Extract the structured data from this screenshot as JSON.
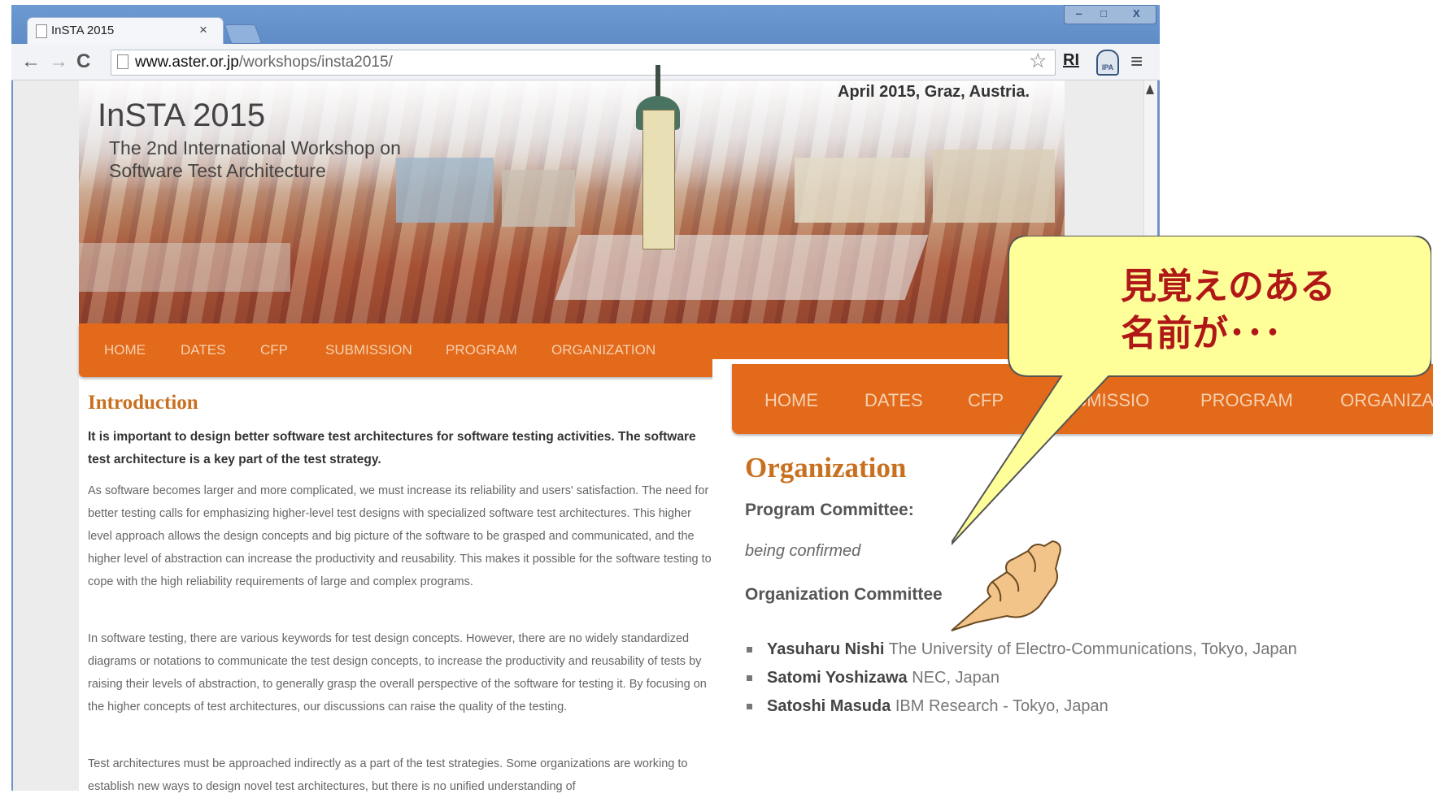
{
  "browser": {
    "tab_title": "InSTA 2015",
    "tab_close": "×",
    "url_domain": "www.aster.or.jp",
    "url_path": "/workshops/insta2015/",
    "extension_ri": "RI",
    "extension_ipa": "IPA",
    "window_controls": {
      "minimize": "‒",
      "maximize": "□",
      "close": "X"
    }
  },
  "banner": {
    "date_location": "April 2015, Graz, Austria.",
    "title": "InSTA 2015",
    "subtitle_line1": "The 2nd International Workshop on",
    "subtitle_line2": "Software Test Architecture"
  },
  "nav": {
    "items": [
      "HOME",
      "DATES",
      "CFP",
      "SUBMISSION",
      "PROGRAM",
      "ORGANIZATION"
    ]
  },
  "introduction": {
    "heading": "Introduction",
    "lead": "It is important to design better software test architectures for software testing activities. The software test architecture is a key part of the test strategy.",
    "paragraph1": "As software becomes larger and more complicated, we must increase its reliability and users' satisfaction. The need for better testing calls for emphasizing higher-level test designs with specialized software test architectures. This higher level approach allows the design concepts and big picture of the software to be grasped and communicated, and the higher level of abstraction can increase the productivity and reusability. This makes it possible for the software testing to cope with the high reliability requirements of large and complex programs.",
    "paragraph2": "In software testing, there are various keywords for test design concepts. However, there are no widely standardized diagrams or notations to communicate the test design concepts, to increase the productivity and reusability of tests by raising their levels of abstraction, to generally grasp the overall perspective of the software for testing it. By focusing on the higher concepts of test architectures, our discussions can raise the quality of the testing.",
    "paragraph3": "Test architectures must be approached indirectly as a part of the test strategies. Some organizations are working to establish new ways to design novel test architectures, but there is no unified understanding of"
  },
  "overlay": {
    "nav_items": [
      "HOME",
      "DATES",
      "CFP",
      "SUBMISSIO",
      "PROGRAM",
      "ORGANIZA"
    ],
    "heading": "Organization",
    "program_committee_label": "Program Committee:",
    "program_committee_value": "being confirmed",
    "organization_committee_label": "Organization Committee",
    "members": [
      {
        "name": "Yasuharu Nishi",
        "affiliation": "The University of Electro-Communications, Tokyo, Japan"
      },
      {
        "name": "Satomi Yoshizawa",
        "affiliation": "NEC, Japan"
      },
      {
        "name": "Satoshi Masuda",
        "affiliation": "IBM Research - Tokyo, Japan"
      }
    ]
  },
  "callout": {
    "line1": "見覚えのある",
    "line2": "名前が･･･"
  },
  "colors": {
    "nav_orange": "#e26a1a",
    "heading_orange": "#c8701f",
    "callout_fill": "#ffff99",
    "callout_text": "#b01818",
    "browser_frame": "#6f95c8"
  },
  "icons": [
    "page-icon",
    "back-arrow-icon",
    "forward-arrow-icon",
    "reload-icon",
    "star-icon",
    "ipa-icon",
    "menu-icon",
    "pointing-hand-icon"
  ]
}
